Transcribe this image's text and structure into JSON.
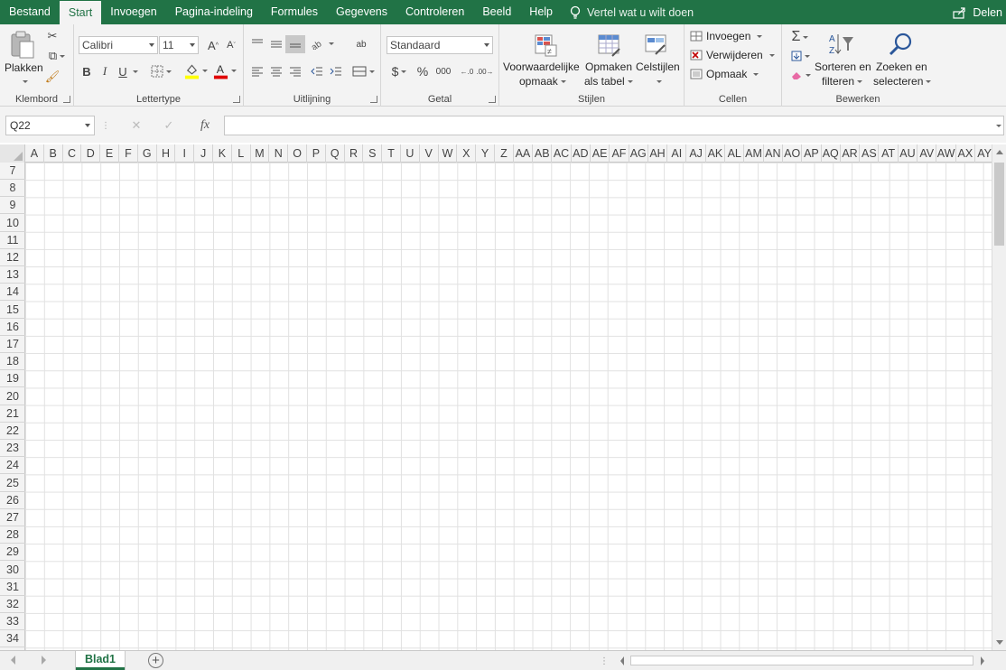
{
  "ribbon_tabs": [
    "Bestand",
    "Start",
    "Invoegen",
    "Pagina-indeling",
    "Formules",
    "Gegevens",
    "Controleren",
    "Beeld",
    "Help"
  ],
  "tell_me": "Vertel wat u wilt doen",
  "share": "Delen",
  "clipboard": {
    "paste": "Plakken",
    "label": "Klembord"
  },
  "font": {
    "name": "Calibri",
    "size": "11",
    "label": "Lettertype",
    "bold": "B",
    "italic": "I",
    "underline": "U"
  },
  "alignment": {
    "label": "Uitlijning"
  },
  "number": {
    "format": "Standaard",
    "label": "Getal",
    "currency": "$",
    "percent": "%",
    "thousands": "000"
  },
  "styles": {
    "conditional_l1": "Voorwaardelijke",
    "conditional_l2": "opmaak",
    "table_l1": "Opmaken",
    "table_l2": "als tabel",
    "cellstyles": "Celstijlen",
    "label": "Stijlen"
  },
  "cells": {
    "insert": "Invoegen",
    "delete": "Verwijderen",
    "format": "Opmaak",
    "label": "Cellen"
  },
  "editing": {
    "sort_l1": "Sorteren en",
    "sort_l2": "filteren",
    "find_l1": "Zoeken en",
    "find_l2": "selecteren",
    "label": "Bewerken"
  },
  "namebox": "Q22",
  "formula_fx": "fx",
  "columns": [
    "A",
    "B",
    "C",
    "D",
    "E",
    "F",
    "G",
    "H",
    "I",
    "J",
    "K",
    "L",
    "M",
    "N",
    "O",
    "P",
    "Q",
    "R",
    "S",
    "T",
    "U",
    "V",
    "W",
    "X",
    "Y",
    "Z",
    "AA",
    "AB",
    "AC",
    "AD",
    "AE",
    "AF",
    "AG",
    "AH",
    "AI",
    "AJ",
    "AK",
    "AL",
    "AM",
    "AN",
    "AO",
    "AP",
    "AQ",
    "AR",
    "AS",
    "AT",
    "AU",
    "AV",
    "AW",
    "AX",
    "AY",
    "A"
  ],
  "rows": [
    "7",
    "8",
    "9",
    "10",
    "11",
    "12",
    "13",
    "14",
    "15",
    "16",
    "17",
    "18",
    "19",
    "20",
    "21",
    "22",
    "23",
    "24",
    "25",
    "26",
    "27",
    "28",
    "29",
    "30",
    "31",
    "32",
    "33",
    "34"
  ],
  "sheet_name": "Blad1",
  "add_sheet": "+",
  "colors": {
    "brand": "#217346",
    "ribbon_bg": "#f3f3f3",
    "grid_line": "#e1e1e1"
  }
}
